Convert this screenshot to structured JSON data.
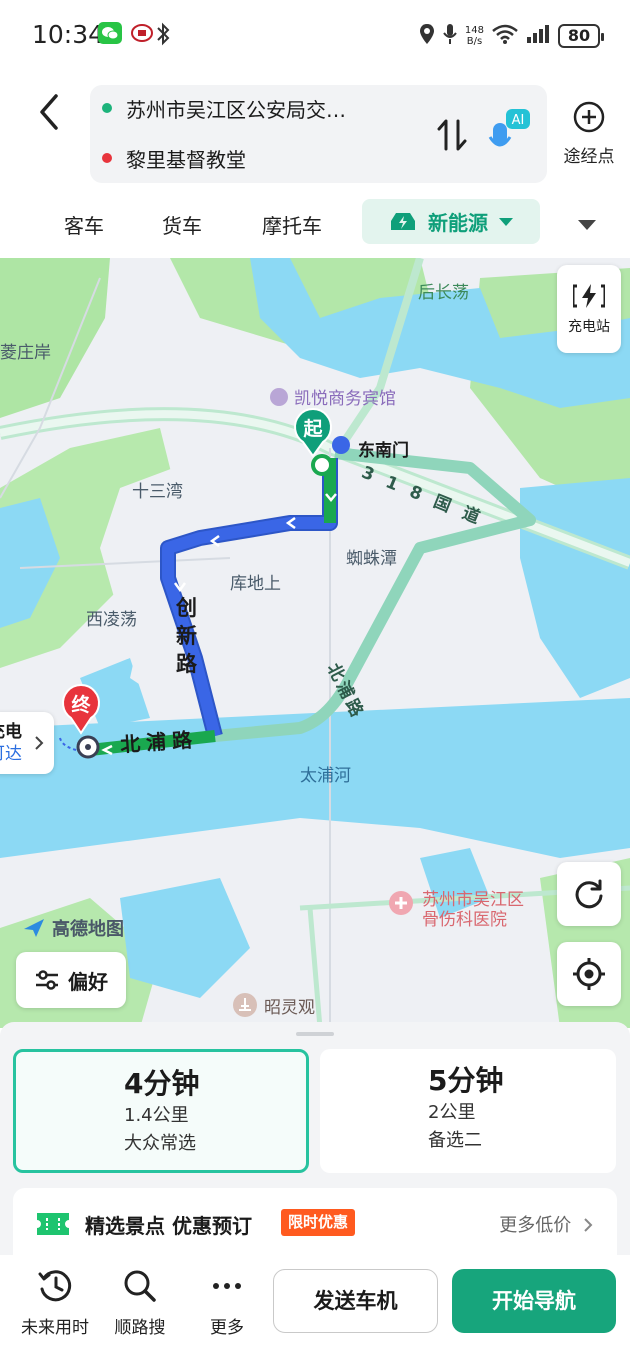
{
  "status_bar": {
    "time": "10:34",
    "net_speed_value": "148",
    "net_speed_unit": "B/s",
    "battery": "80",
    "icons": [
      "wechat-icon",
      "app-icon",
      "bluetooth-icon",
      "location-icon",
      "mic-icon",
      "wifi-icon",
      "signal-icon",
      "battery-icon"
    ]
  },
  "header": {
    "origin": "苏州市吴江区公安局交…",
    "destination": "黎里基督教堂",
    "ai_badge": "AI",
    "waypoint_label": "途经点",
    "origin_color": "#1db37b",
    "destination_color": "#e8343c"
  },
  "tabs": {
    "items": [
      "客车",
      "货车",
      "摩托车"
    ],
    "active": "新能源"
  },
  "map": {
    "labels": {
      "hou_chang_dang": "后长荡",
      "ling_zhuang_an": "菱庄岸",
      "kaiyue_hotel": "凯悦商务宾馆",
      "dong_nan_men": "东南门",
      "guodao": "318国道",
      "shi_san_wan": "十三湾",
      "zhi_zhu_tan": "蜘蛛潭",
      "ku_di_shang": "库地上",
      "xi_ling_dang": "西凌荡",
      "chuangxin_road": "创新路",
      "beipu_road_alt": "北浦路",
      "beipu_road": "北浦路",
      "tai_pu_he": "太浦河",
      "hospital_line1": "苏州市吴江区",
      "hospital_line2": "骨伤科医院",
      "zhaoling_guan": "昭灵观",
      "amap_logo": "高德地图"
    },
    "start_marker": "起",
    "end_marker": "终",
    "left_card": {
      "line1": "充电",
      "line2": "可达"
    },
    "charging_station_label": "充电站",
    "preference_label": "偏好",
    "colors": {
      "water": "#8cd9f4",
      "green": "#a9e6a0",
      "route_blue": "#3a66e6",
      "route_green": "#1aa84f",
      "alt_route": "#8fd5bb"
    }
  },
  "routes": [
    {
      "duration": "4分钟",
      "distance": "1.4公里",
      "tag": "大众常选",
      "selected": true
    },
    {
      "duration": "5分钟",
      "distance": "2公里",
      "tag": "备选二",
      "selected": false
    }
  ],
  "promo": {
    "title": "精选景点 优惠预订",
    "tag": "限时优惠",
    "more": "更多低价"
  },
  "bottom_bar": {
    "future_time": "未来用时",
    "along_search": "顺路搜",
    "more": "更多",
    "send_to_car": "发送车机",
    "start_nav": "开始导航"
  }
}
